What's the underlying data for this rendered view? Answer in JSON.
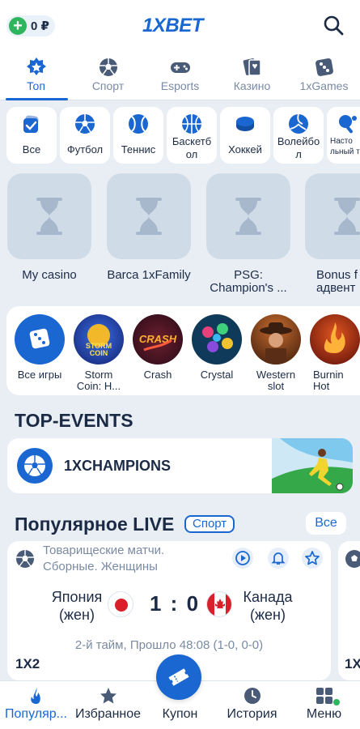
{
  "header": {
    "balance": "0 ₽",
    "logo": "1XBET"
  },
  "tabs": [
    {
      "label": "Топ",
      "icon": "gear-star-icon",
      "active": true
    },
    {
      "label": "Спорт",
      "icon": "soccer-ball-icon"
    },
    {
      "label": "Esports",
      "icon": "gamepad-icon"
    },
    {
      "label": "Казино",
      "icon": "cards-icon"
    },
    {
      "label": "1xGames",
      "icon": "dice-icon"
    }
  ],
  "sports": [
    {
      "label": "Все",
      "icon": "check-badge-icon"
    },
    {
      "label": "Футбол",
      "icon": "soccer-ball-icon"
    },
    {
      "label": "Теннис",
      "icon": "tennis-ball-icon"
    },
    {
      "label": "Баскетб ол",
      "icon": "basketball-icon"
    },
    {
      "label": "Хоккей",
      "icon": "hockey-puck-icon"
    },
    {
      "label": "Волейбо л",
      "icon": "volleyball-icon"
    },
    {
      "label": "Насто льный те",
      "icon": "table-tennis-icon"
    }
  ],
  "promos": [
    {
      "label": "My casino"
    },
    {
      "label": "Barca 1xFamily"
    },
    {
      "label": "PSG: Champion's ..."
    },
    {
      "label": "Bonus f - адвент"
    }
  ],
  "games": [
    {
      "label": "Все игры",
      "icon": "dice-icon"
    },
    {
      "label": "Storm Coin: H...",
      "art": "STORM COIN"
    },
    {
      "label": "Crash",
      "art": "CRASH"
    },
    {
      "label": "Crystal"
    },
    {
      "label": "Western slot"
    },
    {
      "label": "Burnin Hot"
    }
  ],
  "top_events": {
    "title": "TOP-EVENTS",
    "card_label": "1XCHAMPIONS"
  },
  "live": {
    "title": "Популярное LIVE",
    "chip": "Спорт",
    "all": "Все",
    "match": {
      "league_line1": "Товарищеские матчи.",
      "league_line2": "Сборные. Женщины",
      "team1_line1": "Япония",
      "team1_line2": "(жен)",
      "team2_line1": "Канада",
      "team2_line2": "(жен)",
      "score": "1 : 0",
      "period": "2-й тайм, Прошло 48:08 (1-0, 0-0)",
      "market": "1X2",
      "market_next": "1X"
    }
  },
  "bottom_nav": [
    {
      "label": "Популяр...",
      "icon": "fire-icon",
      "active": true
    },
    {
      "label": "Избранное",
      "icon": "star-icon"
    },
    {
      "label": "Купон",
      "icon": "ticket-icon"
    },
    {
      "label": "История",
      "icon": "clock-icon"
    },
    {
      "label": "Меню",
      "icon": "menu-grid-icon"
    }
  ],
  "colors": {
    "accent": "#1a67d2",
    "background": "#e9eef5",
    "positive": "#2fb55e"
  }
}
